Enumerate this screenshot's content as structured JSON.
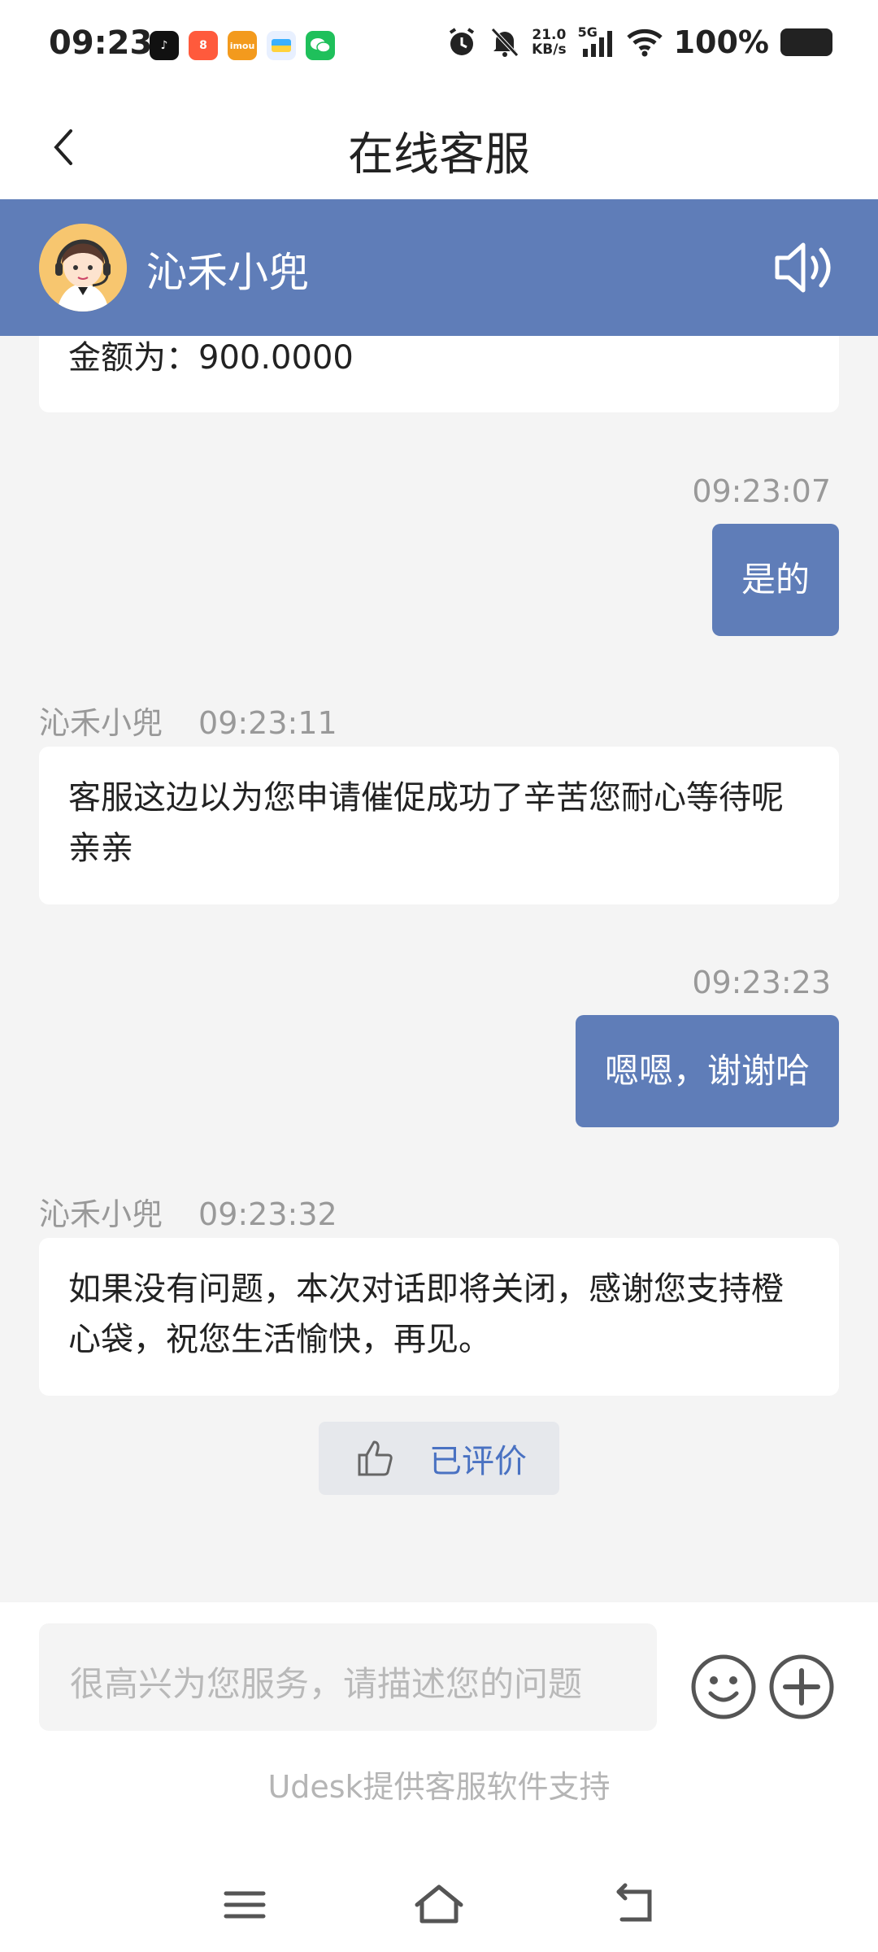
{
  "status_bar": {
    "time": "09:23",
    "net_speed_value": "21.0",
    "net_speed_unit": "KB/s",
    "network": "5G",
    "battery": "100%",
    "app_icons": [
      "tiktok-icon",
      "xiaohongshu-icon",
      "imou-icon",
      "wallet-icon",
      "wechat-icon"
    ]
  },
  "header": {
    "title": "在线客服"
  },
  "agent": {
    "name": "沁禾小兜"
  },
  "messages": [
    {
      "from": "agent",
      "text": "金额为：900.0000"
    },
    {
      "from": "user",
      "time": "09:23:07",
      "text": "是的"
    },
    {
      "from": "agent",
      "sender": "沁禾小兜",
      "time": "09:23:11",
      "text": "客服这边以为您申请催促成功了辛苦您耐心等待呢亲亲"
    },
    {
      "from": "user",
      "time": "09:23:23",
      "text": "嗯嗯，谢谢哈"
    },
    {
      "from": "agent",
      "sender": "沁禾小兜",
      "time": "09:23:32",
      "text": "如果没有问题，本次对话即将关闭，感谢您支持橙心袋，祝您生活愉快，再见。"
    }
  ],
  "rating": {
    "label": "已评价"
  },
  "input": {
    "placeholder": "很高兴为您服务，请描述您的问题"
  },
  "footer": {
    "powered_by": "Udesk提供客服软件支持"
  },
  "colors": {
    "accent": "#5f7db8",
    "rated_text": "#4a72c2",
    "background": "#f4f4f4"
  }
}
